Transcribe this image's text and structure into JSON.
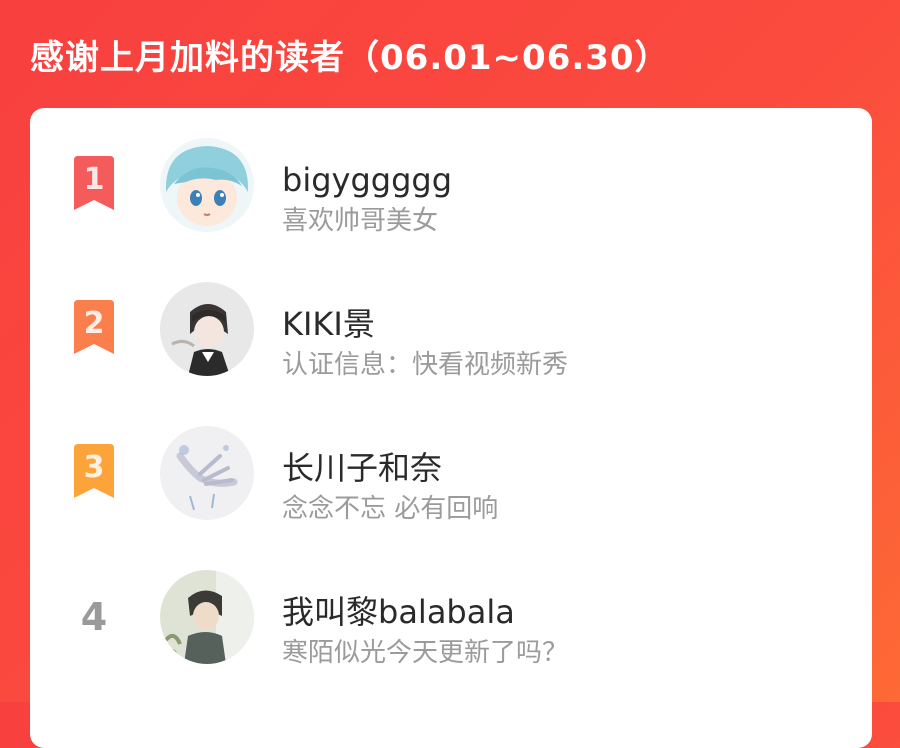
{
  "header": {
    "title": "感谢上月加料的读者（06.01~06.30）"
  },
  "readers": [
    {
      "rank": "1",
      "name": "bigyggggg",
      "desc": "喜欢帅哥美女",
      "badge_color": "#f45b5b",
      "avatar_icon": "anime-boy-blue-hair-avatar"
    },
    {
      "rank": "2",
      "name": "KIKI景",
      "desc": "认证信息：快看视频新秀",
      "badge_color": "#fb7f4d",
      "avatar_icon": "dark-hair-sketch-avatar"
    },
    {
      "rank": "3",
      "name": "长川子和奈",
      "desc": "念念不忘 必有回响",
      "badge_color": "#fca43a",
      "avatar_icon": "watercolor-hand-avatar"
    },
    {
      "rank": "4",
      "name": "我叫黎balabala",
      "desc": "寒陌似光今天更新了吗？",
      "avatar_icon": "boy-in-light-avatar"
    }
  ]
}
